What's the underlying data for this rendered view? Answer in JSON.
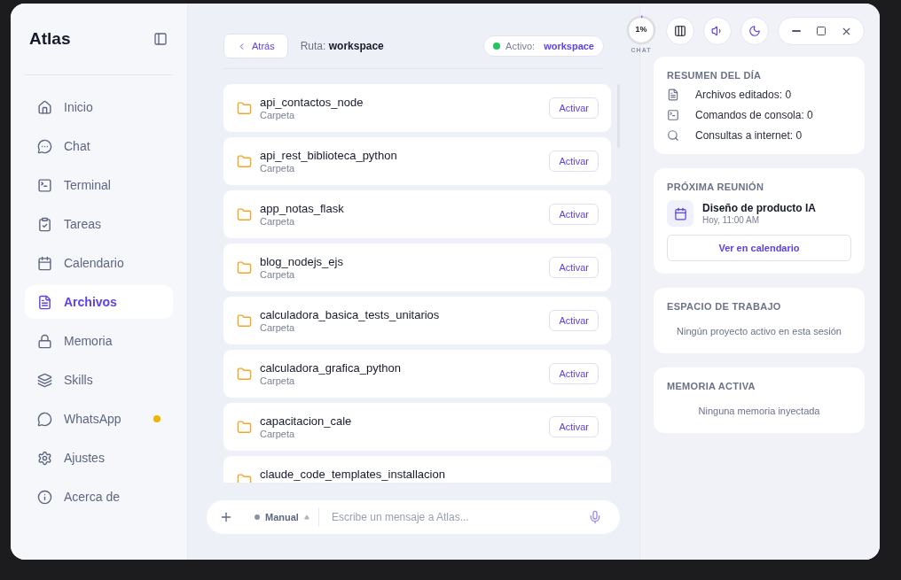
{
  "app": {
    "title": "Atlas"
  },
  "nav": [
    {
      "label": "Inicio",
      "selected": false,
      "alert": false
    },
    {
      "label": "Chat",
      "selected": false,
      "alert": false
    },
    {
      "label": "Terminal",
      "selected": false,
      "alert": false
    },
    {
      "label": "Tareas",
      "selected": false,
      "alert": false
    },
    {
      "label": "Calendario",
      "selected": false,
      "alert": false
    },
    {
      "label": "Archivos",
      "selected": true,
      "alert": false
    },
    {
      "label": "Memoria",
      "selected": false,
      "alert": false
    },
    {
      "label": "Skills",
      "selected": false,
      "alert": false
    },
    {
      "label": "WhatsApp",
      "selected": false,
      "alert": true
    },
    {
      "label": "Ajustes",
      "selected": false,
      "alert": false
    },
    {
      "label": "Acerca de",
      "selected": false,
      "alert": false
    }
  ],
  "toolbar": {
    "back": "Atrás",
    "path_label": "Ruta:",
    "path": "workspace",
    "active_label": "Activo:",
    "active": "workspace"
  },
  "files": [
    {
      "name": "api_contactos_node",
      "type": "Carpeta",
      "action": "Activar"
    },
    {
      "name": "api_rest_biblioteca_python",
      "type": "Carpeta",
      "action": "Activar"
    },
    {
      "name": "app_notas_flask",
      "type": "Carpeta",
      "action": "Activar"
    },
    {
      "name": "blog_nodejs_ejs",
      "type": "Carpeta",
      "action": "Activar"
    },
    {
      "name": "calculadora_basica_tests_unitarios",
      "type": "Carpeta",
      "action": "Activar"
    },
    {
      "name": "calculadora_grafica_python",
      "type": "Carpeta",
      "action": "Activar"
    },
    {
      "name": "capacitacion_cale",
      "type": "Carpeta",
      "action": "Activar"
    },
    {
      "name": "claude_code_templates_installacion"
    }
  ],
  "composer": {
    "mode": "Manual",
    "placeholder": "Escribe un mensaje a Atlas..."
  },
  "context": {
    "value": "1%",
    "label": "CHAT",
    "level": 0.01
  },
  "summary": {
    "title": "RESUMEN DEL DÍA",
    "items": [
      "Archivos editados: 0",
      "Comandos de consola: 0",
      "Consultas a internet: 0"
    ]
  },
  "meeting": {
    "title": "PRÓXIMA REUNIÓN",
    "name": "Diseño de producto IA",
    "time": "Hoy, 11:00 AM",
    "button": "Ver en calendario"
  },
  "workspace": {
    "title": "ESPACIO DE TRABAJO",
    "empty": "Ningún proyecto activo en esta sesión"
  },
  "memory": {
    "title": "MEMORIA ACTIVA",
    "empty": "Ninguna memoria inyectada"
  }
}
